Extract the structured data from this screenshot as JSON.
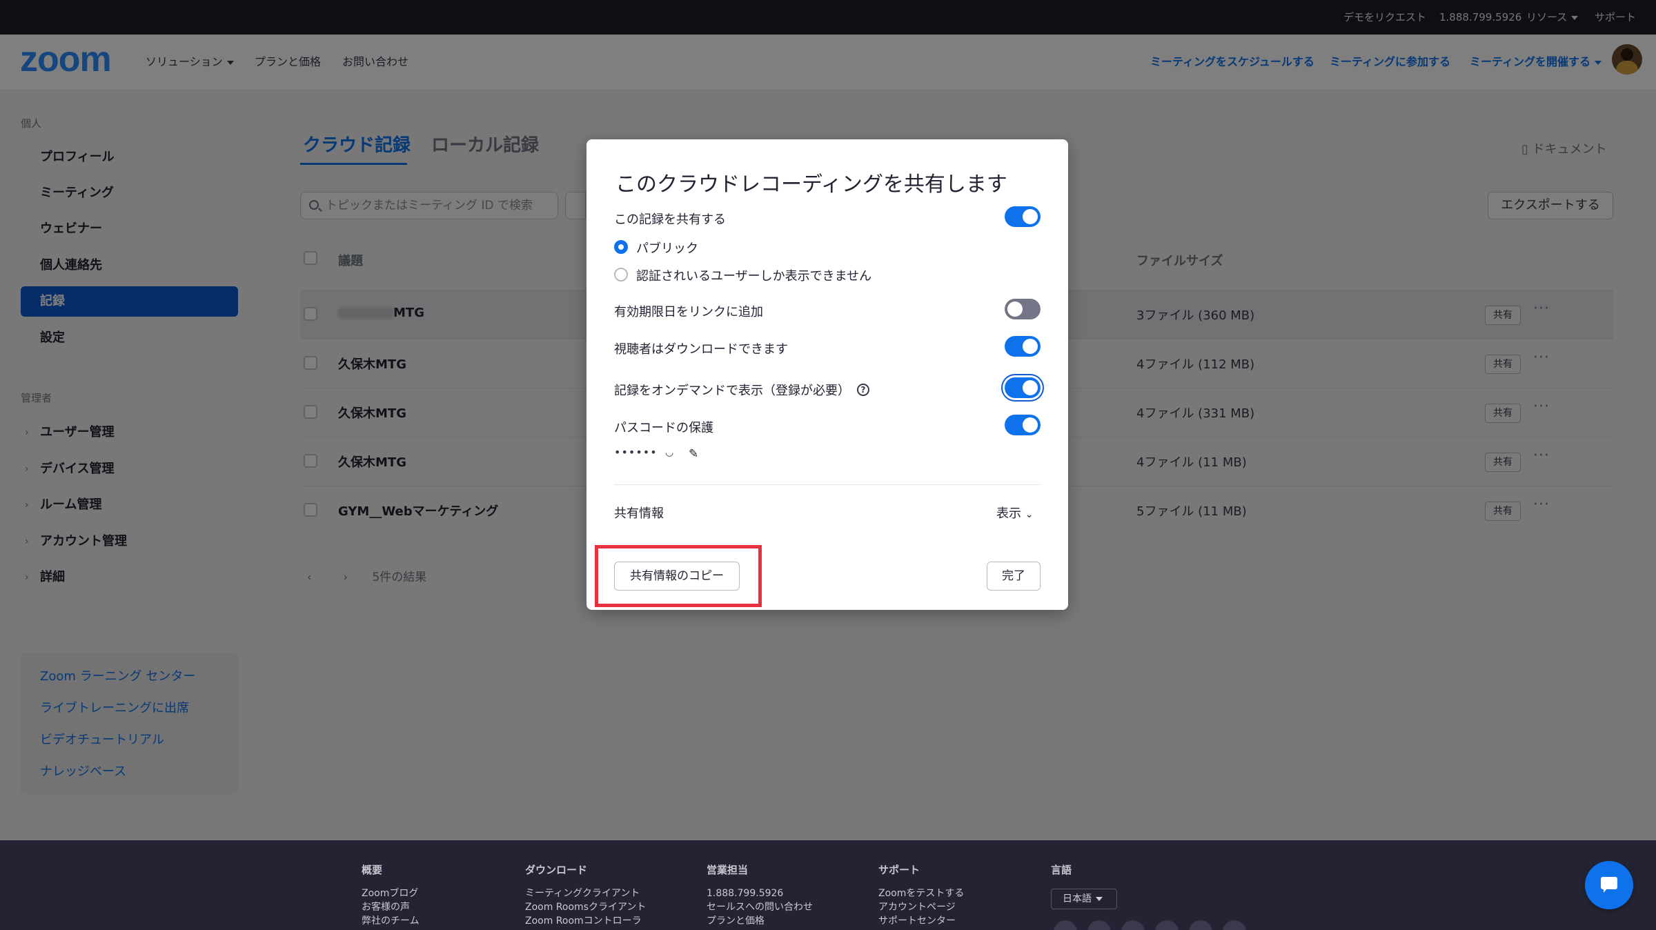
{
  "topbar": {
    "demo": "デモをリクエスト",
    "phone": "1.888.799.5926",
    "resources": "リソース",
    "support": "サポート"
  },
  "header": {
    "logo": "zoom",
    "nav": [
      "ソリューション",
      "プランと価格",
      "お問い合わせ"
    ],
    "actions": {
      "schedule": "ミーティングをスケジュールする",
      "join": "ミーティングに参加する",
      "host": "ミーティングを開催する"
    }
  },
  "sidebar": {
    "personal_label": "個人",
    "personal": [
      "プロフィール",
      "ミーティング",
      "ウェビナー",
      "個人連絡先",
      "記録",
      "設定"
    ],
    "admin_label": "管理者",
    "admin": [
      "ユーザー管理",
      "デバイス管理",
      "ルーム管理",
      "アカウント管理",
      "詳細"
    ],
    "learning": [
      "Zoom ラーニング センター",
      "ライブトレーニングに出席",
      "ビデオチュートリアル",
      "ナレッジベース"
    ]
  },
  "main": {
    "tabs": [
      "クラウド記録",
      "ローカル記録"
    ],
    "doc": "ドキュメント",
    "search_placeholder": "トピックまたはミーティング ID で検索",
    "export": "エクスポートする",
    "columns": {
      "topic": "議題",
      "filesize": "ファイルサイズ"
    },
    "rows": [
      {
        "title": "MTG",
        "size": "3ファイル (360 MB)",
        "share": "共有"
      },
      {
        "title": "久保木MTG",
        "size": "4ファイル (112 MB)",
        "share": "共有"
      },
      {
        "title": "久保木MTG",
        "size": "4ファイル (331 MB)",
        "share": "共有"
      },
      {
        "title": "久保木MTG",
        "size": "4ファイル (11 MB)",
        "share": "共有"
      },
      {
        "title": "GYM__Webマーケティング",
        "size": "5ファイル (11 MB)",
        "share": "共有"
      }
    ],
    "results": "5件の結果"
  },
  "modal": {
    "title": "このクラウドレコーディングを共有します",
    "share_record": "この記録を共有する",
    "public": "パブリック",
    "auth_only": "認証されいるユーザーしか表示できません",
    "expiry": "有効期限日をリンクに追加",
    "download": "視聴者はダウンロードできます",
    "on_demand": "記録をオンデマンドで表示（登録が必要）",
    "passcode": "パスコードの保護",
    "passcode_mask": "••••••",
    "share_info": "共有情報",
    "show": "表示",
    "copy_btn": "共有情報のコピー",
    "done_btn": "完了",
    "toggles": {
      "share": true,
      "expiry": false,
      "download": true,
      "on_demand": true,
      "passcode": true
    }
  },
  "footer": {
    "cols": [
      {
        "heading": "概要",
        "links": [
          "Zoomブログ",
          "お客様の声",
          "弊社のチーム"
        ]
      },
      {
        "heading": "ダウンロード",
        "links": [
          "ミーティングクライアント",
          "Zoom Roomsクライアント",
          "Zoom Roomコントローラ"
        ]
      },
      {
        "heading": "営業担当",
        "links": [
          "1.888.799.5926",
          "セールスへの問い合わせ",
          "プランと価格"
        ]
      },
      {
        "heading": "サポート",
        "links": [
          "Zoomをテストする",
          "アカウントページ",
          "サポートセンター"
        ]
      },
      {
        "heading": "言語",
        "links": []
      }
    ],
    "language": "日本語"
  },
  "colors": {
    "brand": "#2d8cff",
    "accent": "#0e72ed",
    "highlight": "#e8303f"
  }
}
